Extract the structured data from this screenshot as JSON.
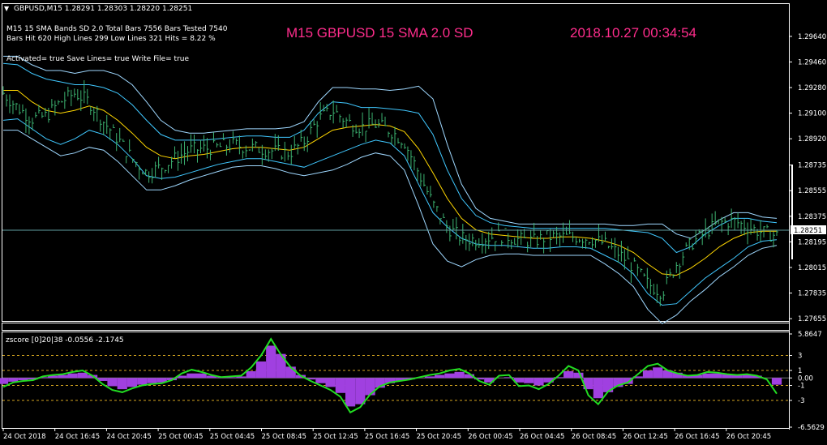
{
  "window": {
    "title": "GBPUSD,M15  1.28291 1.28303 1.28220 1.28251",
    "menu_arrow_icon": "triangle-down-icon"
  },
  "info": {
    "line1": "M15  15 SMA  Bands SD 2.0  Total Bars 7556  Bars Tested 7540",
    "line2": "Bars Hit 620  High Lines 299  Low Lines 321  Hits = 8.22 %",
    "line3": "Activated= true  Save Lines= true  Write File= true",
    "headline": "M15   GBPUSD  15 SMA  2.0 SD",
    "timestamp": "2018.10.27 00:34:54"
  },
  "colors": {
    "background": "#000000",
    "price": "#3cb371",
    "sma": "#ffd700",
    "band_inner": "#40c8ff",
    "band_outer": "#9fd8ff",
    "headline": "#ff2d8c",
    "zscore_line": "#22dd22",
    "zscore_hist": "#a040e0",
    "level_dash": "#d4a520"
  },
  "chart_data": [
    {
      "type": "line",
      "name": "price",
      "ylim": [
        1.2765,
        1.2985
      ],
      "y_ticks": [
        "1.29640",
        "1.29460",
        "1.29280",
        "1.29100",
        "1.28920",
        "1.28735",
        "1.28555",
        "1.28375",
        "1.28195",
        "1.28015",
        "1.27835",
        "1.27655"
      ],
      "current_price_label": "1.28251",
      "current_price": 1.28251,
      "x_tick_labels": [
        "24 Oct 2018",
        "24 Oct 16:45",
        "24 Oct 20:45",
        "25 Oct 00:45",
        "25 Oct 04:45",
        "25 Oct 08:45",
        "25 Oct 12:45",
        "25 Oct 16:45",
        "25 Oct 20:45",
        "26 Oct 00:45",
        "26 Oct 04:45",
        "26 Oct 08:45",
        "26 Oct 12:45",
        "26 Oct 16:45",
        "26 Oct 20:45"
      ],
      "series": [
        {
          "values": [
            1.2924,
            1.2914,
            1.2906,
            1.2908,
            1.2918,
            1.2924,
            1.2918,
            1.2904,
            1.2892,
            1.2878,
            1.2868,
            1.2872,
            1.2878,
            1.2884,
            1.2885,
            1.2886,
            1.2888,
            1.2886,
            1.2885,
            1.2883,
            1.2882,
            1.289,
            1.2906,
            1.2912,
            1.2904,
            1.29,
            1.2902,
            1.2898,
            1.289,
            1.2868,
            1.2846,
            1.283,
            1.2822,
            1.2821,
            1.2823,
            1.2824,
            1.2821,
            1.282,
            1.2823,
            1.2823,
            1.2823,
            1.2822,
            1.2818,
            1.2811,
            1.2802,
            1.279,
            1.2784,
            1.2804,
            1.2818,
            1.2826,
            1.2833,
            1.2834,
            1.283,
            1.2826,
            1.2824
          ]
        },
        {
          "values": [
            1.2926,
            1.2926,
            1.2918,
            1.2912,
            1.291,
            1.2912,
            1.2915,
            1.2912,
            1.2905,
            1.2896,
            1.2886,
            1.288,
            1.2878,
            1.288,
            1.2881,
            1.2883,
            1.2885,
            1.2886,
            1.2886,
            1.2885,
            1.2884,
            1.2886,
            1.2892,
            1.2898,
            1.29,
            1.2901,
            1.2902,
            1.2901,
            1.2897,
            1.2885,
            1.2868,
            1.285,
            1.2836,
            1.2828,
            1.2825,
            1.2824,
            1.2823,
            1.2822,
            1.2822,
            1.2823,
            1.2823,
            1.2822,
            1.282,
            1.2817,
            1.2812,
            1.2804,
            1.2797,
            1.2796,
            1.2801,
            1.2808,
            1.2816,
            1.2822,
            1.2826,
            1.2827,
            1.2827
          ]
        },
        {
          "values": [
            1.2945,
            1.2944,
            1.2938,
            1.2934,
            1.2932,
            1.293,
            1.293,
            1.2928,
            1.2924,
            1.2916,
            1.2905,
            1.2895,
            1.2891,
            1.2891,
            1.2891,
            1.2892,
            1.2893,
            1.2894,
            1.2894,
            1.2893,
            1.2893,
            1.2898,
            1.291,
            1.2918,
            1.2917,
            1.2914,
            1.2914,
            1.2913,
            1.2912,
            1.291,
            1.2895,
            1.287,
            1.285,
            1.2838,
            1.2833,
            1.2831,
            1.283,
            1.2829,
            1.2829,
            1.2829,
            1.2829,
            1.2829,
            1.2829,
            1.2828,
            1.2827,
            1.2826,
            1.2822,
            1.2812,
            1.2816,
            1.2825,
            1.2831,
            1.2836,
            1.2836,
            1.2834,
            1.2833
          ]
        },
        {
          "values": [
            1.2905,
            1.2906,
            1.2899,
            1.2892,
            1.2888,
            1.2892,
            1.2898,
            1.2895,
            1.2888,
            1.2878,
            1.2866,
            1.2864,
            1.2865,
            1.2868,
            1.2871,
            1.2874,
            1.2876,
            1.2878,
            1.2878,
            1.2876,
            1.2874,
            1.2872,
            1.2876,
            1.288,
            1.2884,
            1.2888,
            1.2891,
            1.2889,
            1.288,
            1.286,
            1.284,
            1.283,
            1.2822,
            1.2818,
            1.2817,
            1.2817,
            1.2816,
            1.2815,
            1.2815,
            1.2816,
            1.2816,
            1.2815,
            1.281,
            1.2805,
            1.2797,
            1.2783,
            1.2775,
            1.2776,
            1.2785,
            1.2794,
            1.2801,
            1.2808,
            1.2816,
            1.282,
            1.2821
          ]
        },
        {
          "values": [
            1.295,
            1.295,
            1.2944,
            1.294,
            1.294,
            1.2938,
            1.294,
            1.294,
            1.2937,
            1.293,
            1.2918,
            1.2905,
            1.2898,
            1.2896,
            1.2896,
            1.2897,
            1.2898,
            1.2899,
            1.2899,
            1.2899,
            1.29,
            1.2904,
            1.2918,
            1.2928,
            1.2928,
            1.2927,
            1.2927,
            1.2926,
            1.2927,
            1.2929,
            1.292,
            1.2888,
            1.286,
            1.2843,
            1.2836,
            1.2834,
            1.2832,
            1.2832,
            1.2832,
            1.2832,
            1.2832,
            1.2832,
            1.2832,
            1.2831,
            1.2831,
            1.2832,
            1.2832,
            1.2825,
            1.2822,
            1.2828,
            1.2835,
            1.284,
            1.284,
            1.2837,
            1.2836
          ]
        },
        {
          "values": [
            1.2898,
            1.2898,
            1.2892,
            1.2886,
            1.288,
            1.2882,
            1.2886,
            1.2884,
            1.2876,
            1.2866,
            1.2856,
            1.2856,
            1.2859,
            1.2863,
            1.2866,
            1.2869,
            1.2872,
            1.2873,
            1.2873,
            1.2871,
            1.2868,
            1.2866,
            1.2868,
            1.287,
            1.2874,
            1.2879,
            1.2882,
            1.288,
            1.287,
            1.2845,
            1.2818,
            1.2806,
            1.2802,
            1.2807,
            1.281,
            1.2811,
            1.2811,
            1.281,
            1.281,
            1.281,
            1.281,
            1.281,
            1.2804,
            1.2797,
            1.2788,
            1.2772,
            1.2762,
            1.2768,
            1.2778,
            1.2786,
            1.2795,
            1.2802,
            1.281,
            1.2815,
            1.2817
          ]
        }
      ]
    },
    {
      "type": "area",
      "name": "zscore",
      "title": "zscore [0]20|38 -0.0556 -2.1745",
      "ylim": [
        -6.5629,
        5.8647
      ],
      "y_ticks": [
        "5.8647",
        "3",
        "1",
        "0.00",
        "-1",
        "-3",
        "-6.5629"
      ],
      "levels": [
        3,
        1,
        -1,
        -3
      ],
      "values": [
        -1.2,
        -0.6,
        -0.4,
        -0.3,
        0.2,
        0.4,
        0.5,
        0.8,
        1.0,
        0.3,
        -0.8,
        -1.6,
        -1.9,
        -1.4,
        -1.0,
        -0.8,
        -0.7,
        -0.3,
        0.6,
        1.1,
        0.8,
        0.4,
        0.1,
        0.2,
        0.3,
        1.4,
        3.0,
        5.2,
        3.1,
        1.4,
        0.3,
        -0.4,
        -1.0,
        -1.6,
        -2.5,
        -4.6,
        -3.9,
        -2.2,
        -1.1,
        -0.6,
        -0.4,
        -0.2,
        0.1,
        0.4,
        0.6,
        1.0,
        1.2,
        0.6,
        -0.4,
        -0.9,
        0.3,
        0.4,
        -1.1,
        -1.0,
        -1.5,
        -0.8,
        0.3,
        1.6,
        1.0,
        -2.3,
        -3.5,
        -1.8,
        -1.0,
        -0.6,
        0.5,
        1.6,
        1.9,
        1.0,
        0.6,
        0.3,
        0.4,
        0.8,
        0.7,
        0.5,
        0.4,
        0.5,
        0.3,
        -0.2,
        -2.1
      ],
      "histogram": [
        -0.8,
        -0.5,
        -0.3,
        -0.2,
        0.1,
        0.3,
        0.4,
        0.6,
        0.7,
        0.4,
        -0.4,
        -1.1,
        -1.5,
        -1.2,
        -0.9,
        -0.7,
        -0.6,
        -0.3,
        0.3,
        0.6,
        0.6,
        0.3,
        0.1,
        0.1,
        0.2,
        0.9,
        2.2,
        4.3,
        3.2,
        1.5,
        0.4,
        -0.2,
        -0.7,
        -1.2,
        -2.0,
        -3.8,
        -3.5,
        -2.3,
        -1.3,
        -0.7,
        -0.4,
        -0.2,
        0.0,
        0.2,
        0.4,
        0.6,
        0.8,
        0.5,
        -0.2,
        -0.6,
        0.0,
        0.1,
        -0.6,
        -0.7,
        -1.0,
        -0.6,
        0.1,
        0.9,
        0.7,
        -1.5,
        -2.7,
        -1.9,
        -1.2,
        -0.8,
        0.2,
        1.0,
        1.4,
        1.0,
        0.7,
        0.4,
        0.4,
        0.6,
        0.6,
        0.5,
        0.4,
        0.4,
        0.3,
        0.0,
        -0.9
      ]
    }
  ]
}
